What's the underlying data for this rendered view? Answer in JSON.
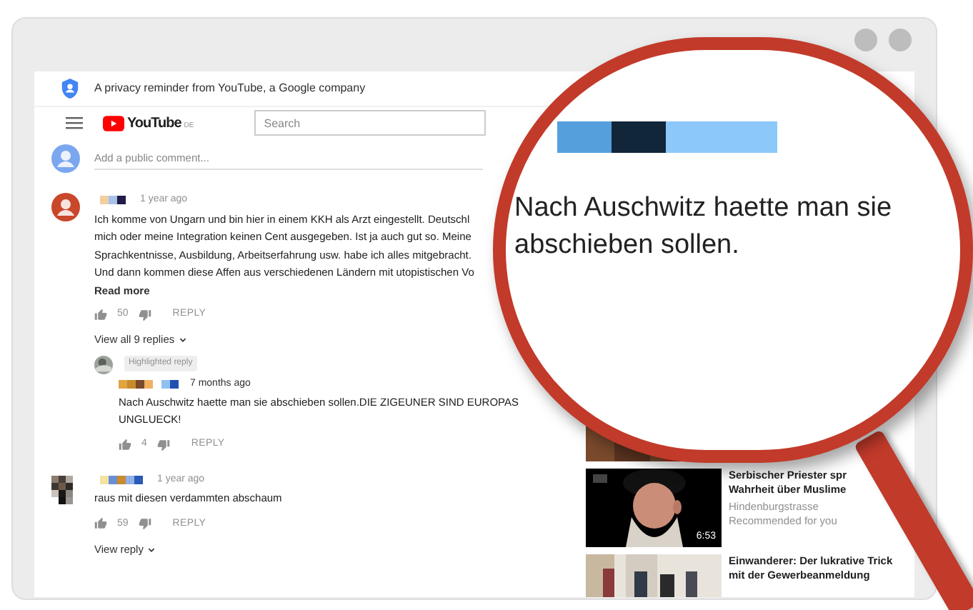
{
  "privacy_notice": {
    "text": "A privacy reminder from YouTube, a Google company"
  },
  "header": {
    "logo": "YouTube",
    "region": "DE",
    "search": {
      "placeholder": "Search"
    }
  },
  "comment_box": {
    "placeholder": "Add a public comment..."
  },
  "comments": [
    {
      "time": "1 year ago",
      "lines": [
        "Ich komme von Ungarn und bin hier in einem KKH als Arzt eingestellt. Deutschl",
        "mich oder meine Integration keinen Cent ausgegeben. Ist ja auch gut so. Meine",
        "Sprachkentnisse, Ausbildung, Arbeitserfahrung usw. habe ich alles mitgebracht.",
        "Und dann kommen diese Affen aus verschiedenen Ländern mit utopistischen Vo"
      ],
      "read_more": "Read more",
      "likes": "50",
      "reply": "REPLY",
      "view_replies": "View all 9 replies",
      "replies": [
        {
          "badge": "Highlighted reply",
          "time": "7 months ago",
          "lines": [
            "Nach Auschwitz haette man sie abschieben sollen.DIE ZIGEUNER SIND EUROPAS",
            "UNGLUECK!"
          ],
          "likes": "4",
          "reply": "REPLY"
        }
      ]
    },
    {
      "time": "1 year ago",
      "lines": [
        "raus mit diesen verdammten abschaum"
      ],
      "likes": "59",
      "reply": "REPLY",
      "view_replies": "View reply"
    }
  ],
  "recommendations": [
    {
      "kind": "picture"
    },
    {
      "kind": "video",
      "title_lines": [
        "Serbischer Priester spr",
        "Wahrheit über Muslime"
      ],
      "channel": "Hindenburgstrasse",
      "note": "Recommended for you",
      "duration": "6:53"
    },
    {
      "kind": "video",
      "title_lines": [
        "Einwanderer: Der lukrative Trick",
        "mit der Gewerbeanmeldung"
      ]
    }
  ],
  "magnifier": {
    "lines": [
      "Nach Auschwitz haette man sie",
      "abschieben sollen."
    ]
  }
}
